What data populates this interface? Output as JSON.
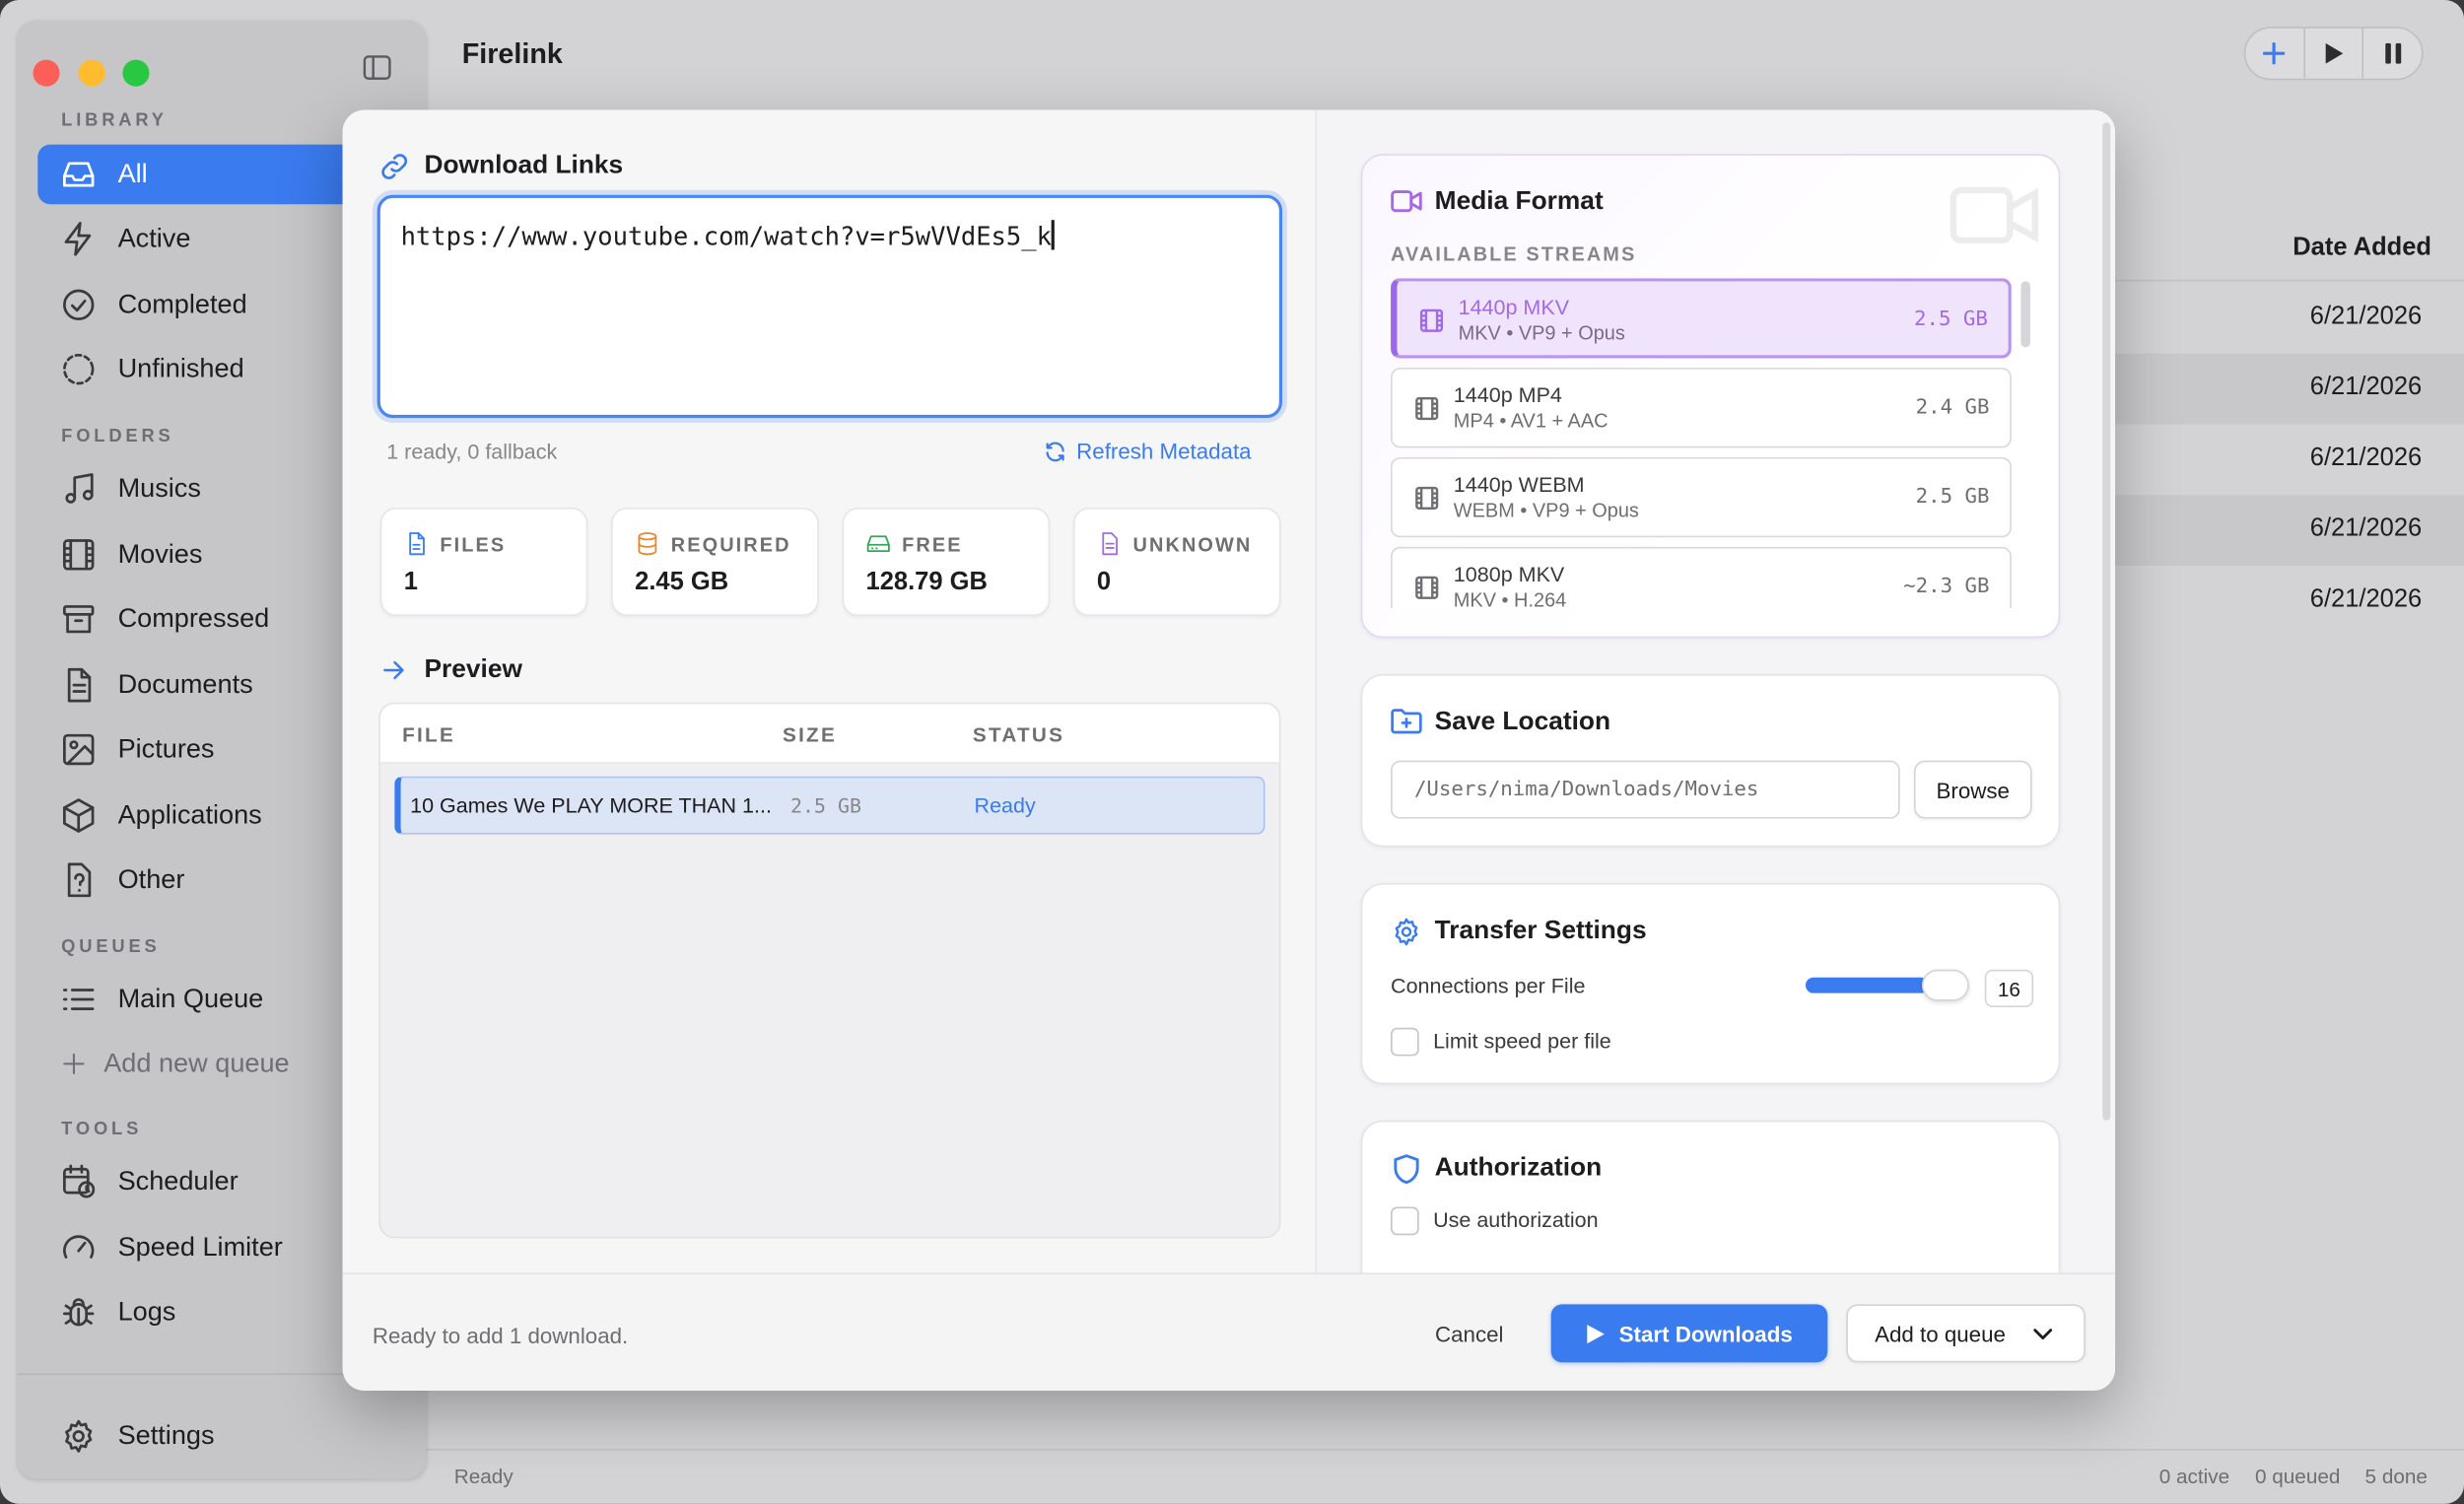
{
  "app": {
    "title": "Firelink"
  },
  "sidebar": {
    "sections": {
      "library": "LIBRARY",
      "folders": "FOLDERS",
      "queues": "QUEUES",
      "tools": "TOOLS"
    },
    "library": [
      "All",
      "Active",
      "Completed",
      "Unfinished"
    ],
    "folders": [
      "Musics",
      "Movies",
      "Compressed",
      "Documents",
      "Pictures",
      "Applications",
      "Other"
    ],
    "queues": [
      "Main Queue",
      "Add new queue"
    ],
    "tools": [
      "Scheduler",
      "Speed Limiter",
      "Logs"
    ],
    "settings": "Settings"
  },
  "background": {
    "date_header": "Date Added",
    "dates": [
      "6/21/2026",
      "6/21/2026",
      "6/21/2026",
      "6/21/2026",
      "6/21/2026"
    ]
  },
  "statusbar": {
    "left": "Ready",
    "active": "0 active",
    "queued": "0 queued",
    "done": "5 done"
  },
  "dialog": {
    "links": {
      "title": "Download Links",
      "url": "https://www.youtube.com/watch?v=r5wVVdEs5_k",
      "summary": "1 ready, 0 fallback",
      "refresh": "Refresh Metadata"
    },
    "stats": [
      {
        "label": "FILES",
        "value": "1"
      },
      {
        "label": "REQUIRED",
        "value": "2.45 GB"
      },
      {
        "label": "FREE",
        "value": "128.79 GB"
      },
      {
        "label": "UNKNOWN",
        "value": "0"
      }
    ],
    "preview": {
      "title": "Preview",
      "columns": [
        "FILE",
        "SIZE",
        "STATUS"
      ],
      "rows": [
        {
          "file": "10 Games We PLAY MORE THAN 1...",
          "size": "2.5 GB",
          "status": "Ready"
        }
      ]
    },
    "media": {
      "title": "Media Format",
      "subtitle": "AVAILABLE STREAMS",
      "streams": [
        {
          "name": "1440p MKV",
          "detail": "MKV • VP9 + Opus",
          "size": "2.5 GB",
          "selected": true
        },
        {
          "name": "1440p MP4",
          "detail": "MP4 • AV1 + AAC",
          "size": "2.4 GB"
        },
        {
          "name": "1440p WEBM",
          "detail": "WEBM • VP9 + Opus",
          "size": "2.5 GB"
        },
        {
          "name": "1080p MKV",
          "detail": "MKV • H.264",
          "size": "~2.3 GB"
        }
      ]
    },
    "save": {
      "title": "Save Location",
      "path": "/Users/nima/Downloads/Movies",
      "browse": "Browse"
    },
    "transfer": {
      "title": "Transfer Settings",
      "connections_label": "Connections per File",
      "connections": "16",
      "connections_fraction": 0.75,
      "limit_label": "Limit speed per file"
    },
    "auth": {
      "title": "Authorization",
      "use_label": "Use authorization"
    },
    "footer": {
      "status": "Ready to add 1 download.",
      "cancel": "Cancel",
      "start": "Start Downloads",
      "queue": "Add to queue"
    }
  },
  "colors": {
    "accent": "#3a7bf0",
    "media_accent": "#a36ae8",
    "required": "#e8872e",
    "free": "#3aa55a",
    "unknown": "#a36ae8"
  }
}
